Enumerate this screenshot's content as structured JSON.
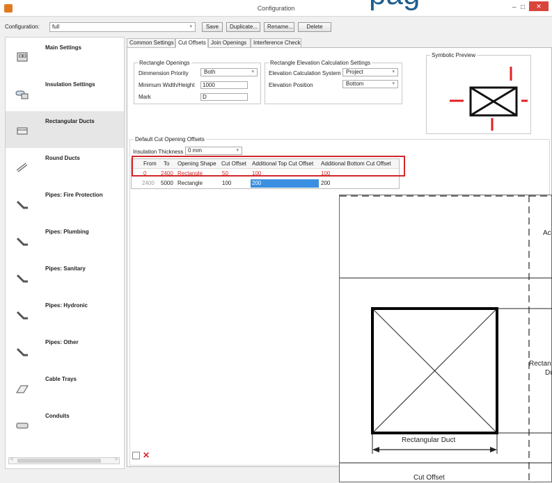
{
  "window": {
    "title": "Configuration",
    "big_title": "pag",
    "minimize": "–",
    "maximize": "□",
    "close": "✕"
  },
  "toolbar": {
    "config_label": "Configuration:",
    "config_value": "full",
    "save": "Save",
    "duplicate": "Duplicate...",
    "rename": "Rename...",
    "delete": "Delete"
  },
  "sidebar": {
    "items": [
      {
        "label": "Main Settings",
        "icon": "main-settings-icon"
      },
      {
        "label": "Insulation Settings",
        "icon": "insulation-icon"
      },
      {
        "label": "Rectangular Ducts",
        "icon": "rect-duct-icon"
      },
      {
        "label": "Round Ducts",
        "icon": "round-duct-icon"
      },
      {
        "label": "Pipes: Fire Protection",
        "icon": "pipe-icon"
      },
      {
        "label": "Pipes: Plumbing",
        "icon": "pipe-icon"
      },
      {
        "label": "Pipes: Sanitary",
        "icon": "pipe-icon"
      },
      {
        "label": "Pipes: Hydronic",
        "icon": "pipe-icon"
      },
      {
        "label": "Pipes: Other",
        "icon": "pipe-icon"
      },
      {
        "label": "Cable Trays",
        "icon": "cable-tray-icon"
      },
      {
        "label": "Conduits",
        "icon": "conduit-icon"
      }
    ]
  },
  "tabs": [
    "Common Settings",
    "Cut Offsets",
    "Join Openings",
    "Interference Check"
  ],
  "rect_openings": {
    "legend": "Rectangle Openings",
    "dim_priority_label": "Dimmension Priority",
    "dim_priority_value": "Both",
    "min_wh_label": "Minimum Width/Height",
    "min_wh_value": "1000",
    "mark_label": "Mark",
    "mark_value": "D"
  },
  "elevation": {
    "legend": "Rectangle Elevation Calculation Settings",
    "system_label": "Elevation Calculation System",
    "system_value": "Project",
    "position_label": "Elevation Position",
    "position_value": "Bottom"
  },
  "preview": {
    "legend": "Symbolic Preview"
  },
  "offsets": {
    "legend": "Default Cut Opening Offsets",
    "insulation_label": "Insulation Thickness",
    "insulation_value": "0 mm",
    "columns": [
      "From",
      "To",
      "Opening Shape",
      "Cut Offset",
      "Additional Top Cut Offset",
      "Additional Bottom Cut Offset"
    ],
    "rows": [
      [
        "0",
        "2400",
        "Rectangle",
        "50",
        "100",
        "100"
      ],
      [
        "2400",
        "5000",
        "Rectangle",
        "100",
        "200",
        "200"
      ]
    ]
  },
  "footer": {
    "add": "□",
    "remove": "✕",
    "scroll_left": "<",
    "scroll_right": ">"
  },
  "diagram": {
    "label_a": "Ac",
    "label_rect": "Rectan",
    "label_du": "Du",
    "duct_label": "Rectangular Duct",
    "cut_offset": "Cut Offset"
  },
  "colors": {
    "highlight": "#d1262b",
    "selection": "#3b8fe0",
    "accent": "#1d5e8f"
  }
}
